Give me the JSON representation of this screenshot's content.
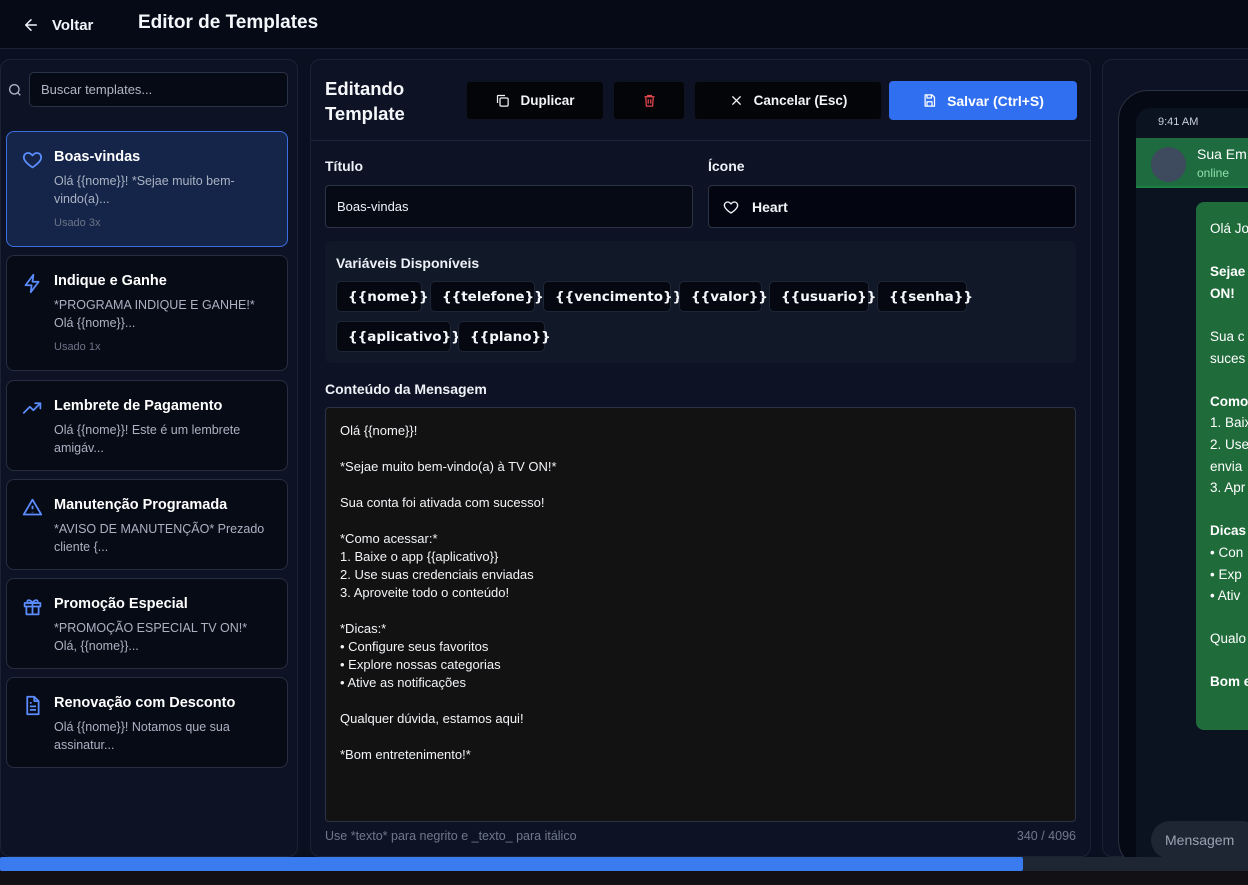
{
  "topbar": {
    "back_label": "Voltar",
    "title": "Editor de Templates"
  },
  "search": {
    "placeholder": "Buscar templates..."
  },
  "templates": [
    {
      "title": "Boas-vindas",
      "preview": "Olá {{nome}}! *Sejae muito bem-vindo(a)...",
      "usage": "Usado 3x",
      "icon": "heart-icon",
      "active": true
    },
    {
      "title": "Indique e Ganhe",
      "preview": "*PROGRAMA INDIQUE E GANHE!* Olá {{nome}}...",
      "usage": "Usado 1x",
      "icon": "lightning-icon"
    },
    {
      "title": "Lembrete de Pagamento",
      "preview": "Olá {{nome}}! Este é um lembrete amigáv...",
      "icon": "trending-up-icon"
    },
    {
      "title": "Manutenção Programada",
      "preview": "*AVISO DE MANUTENÇÃO* Prezado cliente {...",
      "icon": "warning-icon"
    },
    {
      "title": "Promoção Especial",
      "preview": "*PROMOÇÃO ESPECIAL TV ON!* Olá, {{nome}}...",
      "icon": "gift-icon"
    },
    {
      "title": "Renovação com Desconto",
      "preview": "Olá {{nome}}! Notamos que sua assinatur...",
      "icon": "document-icon"
    }
  ],
  "editor": {
    "title": "Editando Template",
    "buttons": {
      "duplicate": "Duplicar",
      "cancel": "Cancelar (Esc)",
      "save": "Salvar (Ctrl+S)"
    },
    "title_label": "Título",
    "title_value": "Boas-vindas",
    "icon_label": "Ícone",
    "icon_value": "Heart",
    "variables_title": "Variáveis Disponíveis",
    "variables": [
      "{{nome}}",
      "{{telefone}}",
      "{{vencimento}}",
      "{{valor}}",
      "{{usuario}}",
      "{{senha}}",
      "{{aplicativo}}",
      "{{plano}}"
    ],
    "content_label": "Conteúdo da Mensagem",
    "content_lines": [
      "Olá {{nome}}!",
      "",
      "*Sejae muito bem-vindo(a) à TV ON!*",
      "",
      "Sua conta foi ativada com sucesso!",
      "",
      "*Como acessar:*",
      "1. Baixe o app {{aplicativo}}",
      "2. Use suas credenciais enviadas",
      "3. Aproveite todo o conteúdo!",
      "",
      "*Dicas:*",
      "• Configure seus favoritos",
      "• Explore nossas categorias",
      "• Ative as notificações",
      "",
      "Qualquer dúvida, estamos aqui!",
      "",
      "*Bom entretenimento!*"
    ],
    "hint": "Use *texto* para negrito e _texto_ para itálico",
    "counter": "340 / 4096"
  },
  "preview": {
    "time": "9:41 AM",
    "contact_name": "Sua Em",
    "contact_status": "online",
    "bubble_lines": [
      {
        "t": "Olá Jo",
        "b": false
      },
      {
        "t": "",
        "b": false
      },
      {
        "t": "Sejae",
        "b": true
      },
      {
        "t": "ON!",
        "b": true
      },
      {
        "t": "",
        "b": false
      },
      {
        "t": "Sua c",
        "b": false
      },
      {
        "t": "suces",
        "b": false
      },
      {
        "t": "",
        "b": false
      },
      {
        "t": "Como",
        "b": true
      },
      {
        "t": "1. Baix",
        "b": false
      },
      {
        "t": "2. Use",
        "b": false
      },
      {
        "t": "envia",
        "b": false
      },
      {
        "t": "3. Apr",
        "b": false
      },
      {
        "t": "",
        "b": false
      },
      {
        "t": "Dicas",
        "b": true
      },
      {
        "t": "• Con",
        "b": false
      },
      {
        "t": "• Exp",
        "b": false
      },
      {
        "t": "• Ativ",
        "b": false
      },
      {
        "t": "",
        "b": false
      },
      {
        "t": "Qualo",
        "b": false
      },
      {
        "t": "",
        "b": false
      },
      {
        "t": "Bom e",
        "b": true
      }
    ],
    "input_placeholder": "Mensagem"
  },
  "scrollbar": {
    "position_fraction": 0.82
  },
  "colors": {
    "accent": "#2f6ff0",
    "active_card": "#152549",
    "bubble": "#1f6b3a",
    "danger": "#e5484d"
  }
}
